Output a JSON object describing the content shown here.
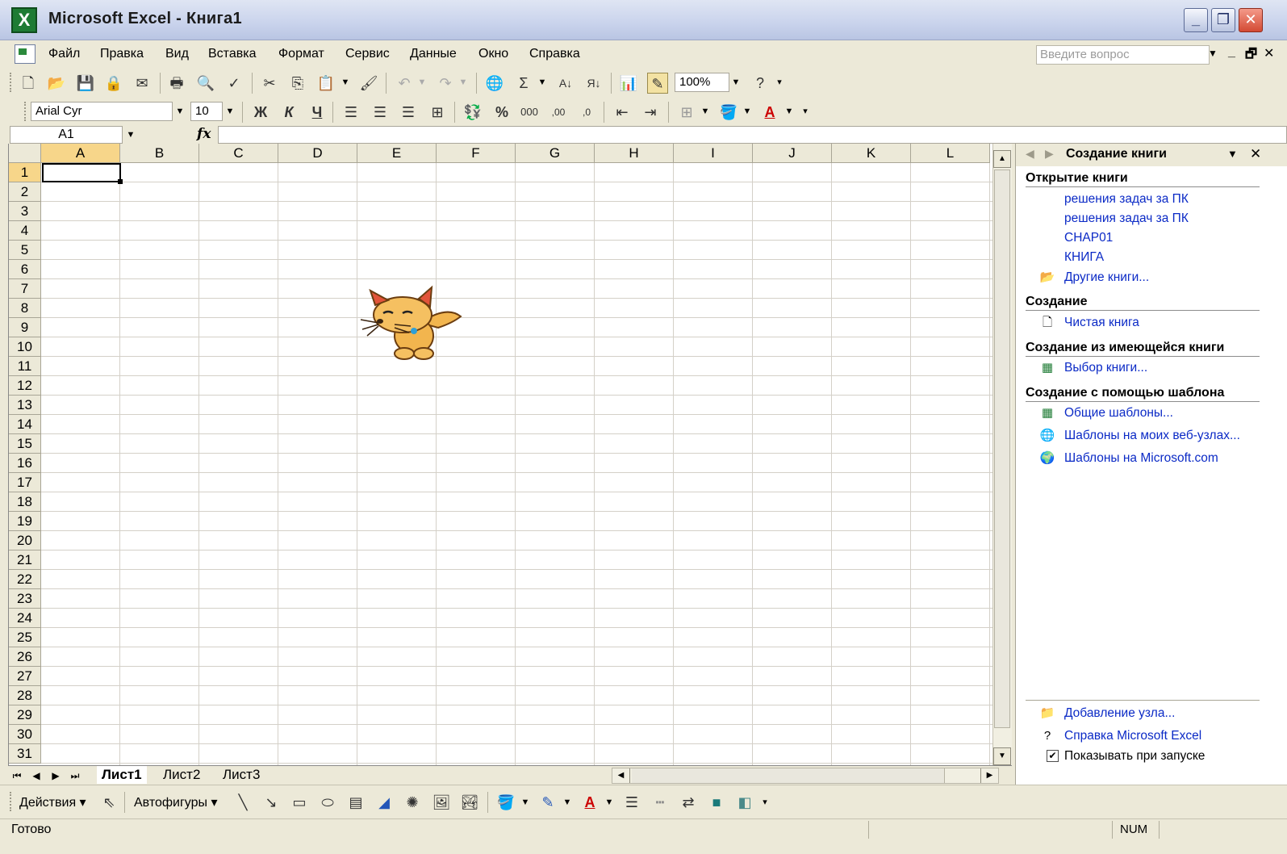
{
  "window": {
    "app_icon": "X",
    "title": "Microsoft Excel - Книга1",
    "minimize": "_",
    "restore": "❐",
    "close": "✕"
  },
  "menu": {
    "items": [
      "Файл",
      "Правка",
      "Вид",
      "Вставка",
      "Формат",
      "Сервис",
      "Данные",
      "Окно",
      "Справка"
    ],
    "help_placeholder": "Введите вопрос",
    "help_arrow": "▼",
    "doc_min": "_",
    "doc_restore": "🗗",
    "doc_close": "✕"
  },
  "toolbar": {
    "font_name": "Arial Cyr",
    "font_size": "10",
    "zoom": "100%",
    "bold_label": "Ж",
    "italic_label": "К",
    "underline_label": "Ч",
    "percent_label": "%",
    "thousands_label": "000",
    "inc_decimal_label": ",00",
    "dec_decimal_label": ",0",
    "sum_label": "Σ",
    "font_color_label": "A",
    "help_label": "?"
  },
  "formula": {
    "name_box": "A1",
    "fx": "fx"
  },
  "grid": {
    "columns": [
      "A",
      "B",
      "C",
      "D",
      "E",
      "F",
      "G",
      "H",
      "I",
      "J",
      "K",
      "L"
    ],
    "rows": [
      "1",
      "2",
      "3",
      "4",
      "5",
      "6",
      "7",
      "8",
      "9",
      "10",
      "11",
      "12",
      "13",
      "14",
      "15",
      "16",
      "17",
      "18",
      "19",
      "20",
      "21",
      "22",
      "23",
      "24",
      "25",
      "26",
      "27",
      "28",
      "29",
      "30",
      "31"
    ],
    "active_cell": "A1"
  },
  "sheet_tabs": [
    "Лист1",
    "Лист2",
    "Лист3"
  ],
  "task_pane": {
    "title": "Создание книги",
    "sections": {
      "open": "Открытие книги",
      "create": "Создание",
      "from_existing": "Создание из имеющейся книги",
      "from_template": "Создание с помощью шаблона"
    },
    "recent": [
      "решения задач за ПК",
      "решения задач за ПК",
      "CHAP01",
      "КНИГА"
    ],
    "more_books": "Другие книги...",
    "blank_book": "Чистая книга",
    "choose_book": "Выбор книги...",
    "general_templates": "Общие шаблоны...",
    "web_templates": "Шаблоны на моих веб-узлах...",
    "ms_templates": "Шаблоны на Microsoft.com",
    "add_place": "Добавление узла...",
    "excel_help": "Справка Microsoft Excel",
    "show_at_startup": "Показывать при запуске"
  },
  "drawing": {
    "actions": "Действия ▾",
    "autoshapes": "Автофигуры ▾"
  },
  "status": {
    "text": "Готово",
    "num": "NUM"
  },
  "colors": {
    "link": "#0b2ac6",
    "excel_green": "#1e7b34"
  }
}
